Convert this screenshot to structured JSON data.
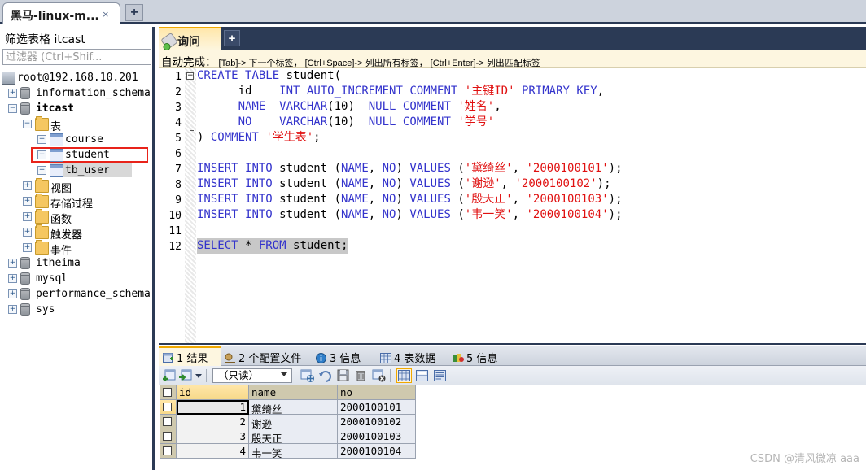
{
  "window": {
    "connection_tab_label": "黑马-linux-m...",
    "connection_tab_close": "×",
    "new_connection_tab": "+"
  },
  "sidebar": {
    "filter_title": "筛选表格 itcast",
    "filter_placeholder": "过滤器 (Ctrl+Shif...",
    "filter_value": "",
    "tree": [
      {
        "label": "root@192.168.10.201",
        "icon": "server-icon",
        "expander": "",
        "depth": 0,
        "bold": false,
        "chinese": false
      },
      {
        "label": "information_schema",
        "icon": "database-icon",
        "expander": "+",
        "depth": 1,
        "bold": false,
        "chinese": false
      },
      {
        "label": "itcast",
        "icon": "database-icon",
        "expander": "−",
        "depth": 1,
        "bold": true,
        "chinese": false
      },
      {
        "label": "表",
        "icon": "folder-icon",
        "expander": "−",
        "depth": 2,
        "bold": false,
        "chinese": true
      },
      {
        "label": "course",
        "icon": "table-icon",
        "expander": "+",
        "depth": 3,
        "bold": false,
        "chinese": false
      },
      {
        "label": "student",
        "icon": "table-icon",
        "expander": "+",
        "depth": 3,
        "bold": false,
        "chinese": false,
        "highlighted": true
      },
      {
        "label": "tb_user",
        "icon": "table-icon",
        "expander": "+",
        "depth": 3,
        "bold": false,
        "chinese": false,
        "selected": true
      },
      {
        "label": "视图",
        "icon": "folder-icon",
        "expander": "+",
        "depth": 2,
        "bold": false,
        "chinese": true
      },
      {
        "label": "存储过程",
        "icon": "folder-icon",
        "expander": "+",
        "depth": 2,
        "bold": false,
        "chinese": true
      },
      {
        "label": "函数",
        "icon": "folder-icon",
        "expander": "+",
        "depth": 2,
        "bold": false,
        "chinese": true
      },
      {
        "label": "触发器",
        "icon": "folder-icon",
        "expander": "+",
        "depth": 2,
        "bold": false,
        "chinese": true
      },
      {
        "label": "事件",
        "icon": "folder-icon",
        "expander": "+",
        "depth": 2,
        "bold": false,
        "chinese": true
      },
      {
        "label": "itheima",
        "icon": "database-icon",
        "expander": "+",
        "depth": 1,
        "bold": false,
        "chinese": false
      },
      {
        "label": "mysql",
        "icon": "database-icon",
        "expander": "+",
        "depth": 1,
        "bold": false,
        "chinese": false
      },
      {
        "label": "performance_schema",
        "icon": "database-icon",
        "expander": "+",
        "depth": 1,
        "bold": false,
        "chinese": false
      },
      {
        "label": "sys",
        "icon": "database-icon",
        "expander": "+",
        "depth": 1,
        "bold": false,
        "chinese": false
      }
    ]
  },
  "query": {
    "tab_label": "询问",
    "new_query_tab": "+",
    "autocomplete_hint_prefix": "自动完成：",
    "autocomplete_hint": " [Tab]-> 下一个标签， [Ctrl+Space]-> 列出所有标签， [Ctrl+Enter]-> 列出匹配标签",
    "line_numbers": [
      "1",
      "2",
      "3",
      "4",
      "5",
      "6",
      "7",
      "8",
      "9",
      "10",
      "11",
      "12"
    ],
    "sql_lines": [
      "CREATE TABLE student(",
      "      id    INT AUTO_INCREMENT COMMENT '主键ID' PRIMARY KEY,",
      "      NAME  VARCHAR(10)  NULL COMMENT '姓名',",
      "      NO    VARCHAR(10)  NULL COMMENT '学号'",
      ") COMMENT '学生表';",
      "",
      "INSERT INTO student (NAME, NO) VALUES ('黛绮丝', '2000100101');",
      "INSERT INTO student (NAME, NO) VALUES ('谢逊', '2000100102');",
      "INSERT INTO student (NAME, NO) VALUES ('殷天正', '2000100103');",
      "INSERT INTO student (NAME, NO) VALUES ('韦一笑', '2000100104');",
      "",
      "SELECT * FROM student;"
    ]
  },
  "results": {
    "tabs": [
      {
        "num": "1",
        "label": "结果",
        "icon": "result-grid-icon",
        "active": true
      },
      {
        "num": "2",
        "label": "个配置文件",
        "icon": "profile-icon",
        "active": false
      },
      {
        "num": "3",
        "label": "信息",
        "icon": "info-icon",
        "active": false
      },
      {
        "num": "4",
        "label": "表数据",
        "icon": "table-data-icon",
        "active": false
      },
      {
        "num": "5",
        "label": "信息",
        "icon": "status-icon",
        "active": false
      }
    ],
    "toolbar": {
      "mode_value": "（只读）",
      "buttons": [
        "insert-row-icon",
        "duplicate-row-icon",
        "dropdown-arrow-icon",
        "add-record-icon",
        "revert-icon",
        "save-icon",
        "delete-icon",
        "discard-icon",
        "grid-view-icon",
        "form-view-icon",
        "field-view-icon"
      ]
    },
    "grid": {
      "columns": [
        "id",
        "name",
        "no"
      ],
      "rows": [
        {
          "id": "1",
          "name": "黛绮丝",
          "no": "2000100101"
        },
        {
          "id": "2",
          "name": "谢逊",
          "no": "2000100102"
        },
        {
          "id": "3",
          "name": "殷天正",
          "no": "2000100103"
        },
        {
          "id": "4",
          "name": "韦一笑",
          "no": "2000100104"
        }
      ]
    }
  },
  "watermark": "CSDN @清风微凉 aaa",
  "colors": {
    "chrome_dark": "#2b3a55",
    "chrome_light": "#cdd3dd",
    "active_tab_accent": "#f0a800",
    "highlight_red": "#e8231a",
    "keyword_blue": "#3333cc",
    "string_red": "#e01010"
  }
}
